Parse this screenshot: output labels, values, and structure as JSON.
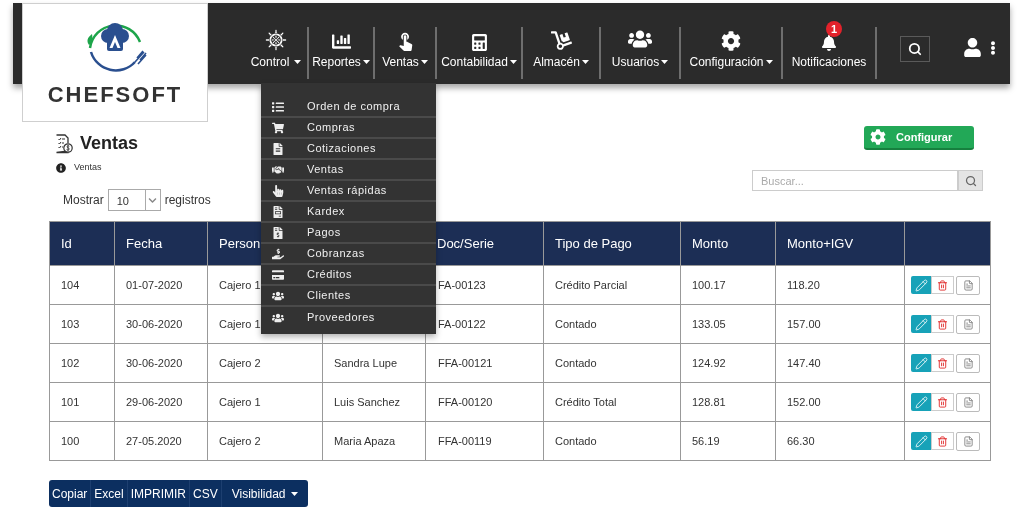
{
  "logo": {
    "name": "CHEFSOFT"
  },
  "nav": {
    "items": [
      {
        "label": "Control",
        "caret": true
      },
      {
        "label": "Reportes",
        "caret": true
      },
      {
        "label": "Ventas",
        "caret": true
      },
      {
        "label": "Contabilidad",
        "caret": true
      },
      {
        "label": "Almacén",
        "caret": true
      },
      {
        "label": "Usuarios",
        "caret": true
      },
      {
        "label": "Configuración",
        "caret": true
      },
      {
        "label": "Notificaciones",
        "caret": false,
        "badge": "1"
      }
    ]
  },
  "dropdown_menu": {
    "items": [
      "Orden de compra",
      "Compras",
      "Cotizaciones",
      "Ventas",
      "Ventas rápidas",
      "Kardex",
      "Pagos",
      "Cobranzas",
      "Créditos",
      "Clientes",
      "Proveedores"
    ]
  },
  "page": {
    "title": "Ventas",
    "breadcrumb": "Ventas",
    "configure_button": "Configurar"
  },
  "length_control": {
    "before": "Mostrar",
    "value": "10",
    "after": "registros"
  },
  "search": {
    "placeholder": "Buscar..."
  },
  "table": {
    "columns": {
      "id": "Id",
      "fecha": "Fecha",
      "column_3": "Person",
      "doc_serie": "Doc/Serie",
      "tipo_de_pago": "Tipo de Pago",
      "monto": "Monto",
      "monto_igv": "Monto+IGV"
    },
    "rows": [
      {
        "id": "104",
        "fecha": "01-07-2020",
        "column_3": "Cajero 1",
        "doc_serie": "FA-00123",
        "tipo_de_pago": "Crédito Parcial",
        "monto": "100.17",
        "monto_igv": "118.20"
      },
      {
        "id": "103",
        "fecha": "30-06-2020",
        "column_3": "Cajero 1",
        "doc_serie": "FA-00122",
        "tipo_de_pago": "Contado",
        "monto": "133.05",
        "monto_igv": "157.00"
      },
      {
        "id": "102",
        "fecha": "30-06-2020",
        "column_3": "Cajero 2",
        "column_4": "Sandra Lupe",
        "doc_serie": "FFA-00121",
        "tipo_de_pago": "Contado",
        "monto": "124.92",
        "monto_igv": "147.40"
      },
      {
        "id": "101",
        "fecha": "29-06-2020",
        "column_3": "Cajero 1",
        "column_4": "Luis Sanchez",
        "doc_serie": "FFA-00120",
        "tipo_de_pago": "Crédito Total",
        "monto": "128.81",
        "monto_igv": "152.00"
      },
      {
        "id": "100",
        "fecha": "27-05.2020",
        "column_3": "Cajero 2",
        "column_4": "Maria Apaza",
        "doc_serie": "FFA-00119",
        "tipo_de_pago": "Contado",
        "monto": "56.19",
        "monto_igv": "66.30"
      }
    ]
  },
  "export_buttons": [
    {
      "label": "Copiar",
      "caret": false
    },
    {
      "label": "Excel",
      "caret": false
    },
    {
      "label": "IMPRIMIR",
      "caret": false
    },
    {
      "label": "CSV",
      "caret": false
    },
    {
      "label": "Visibilidad",
      "caret": true
    }
  ]
}
